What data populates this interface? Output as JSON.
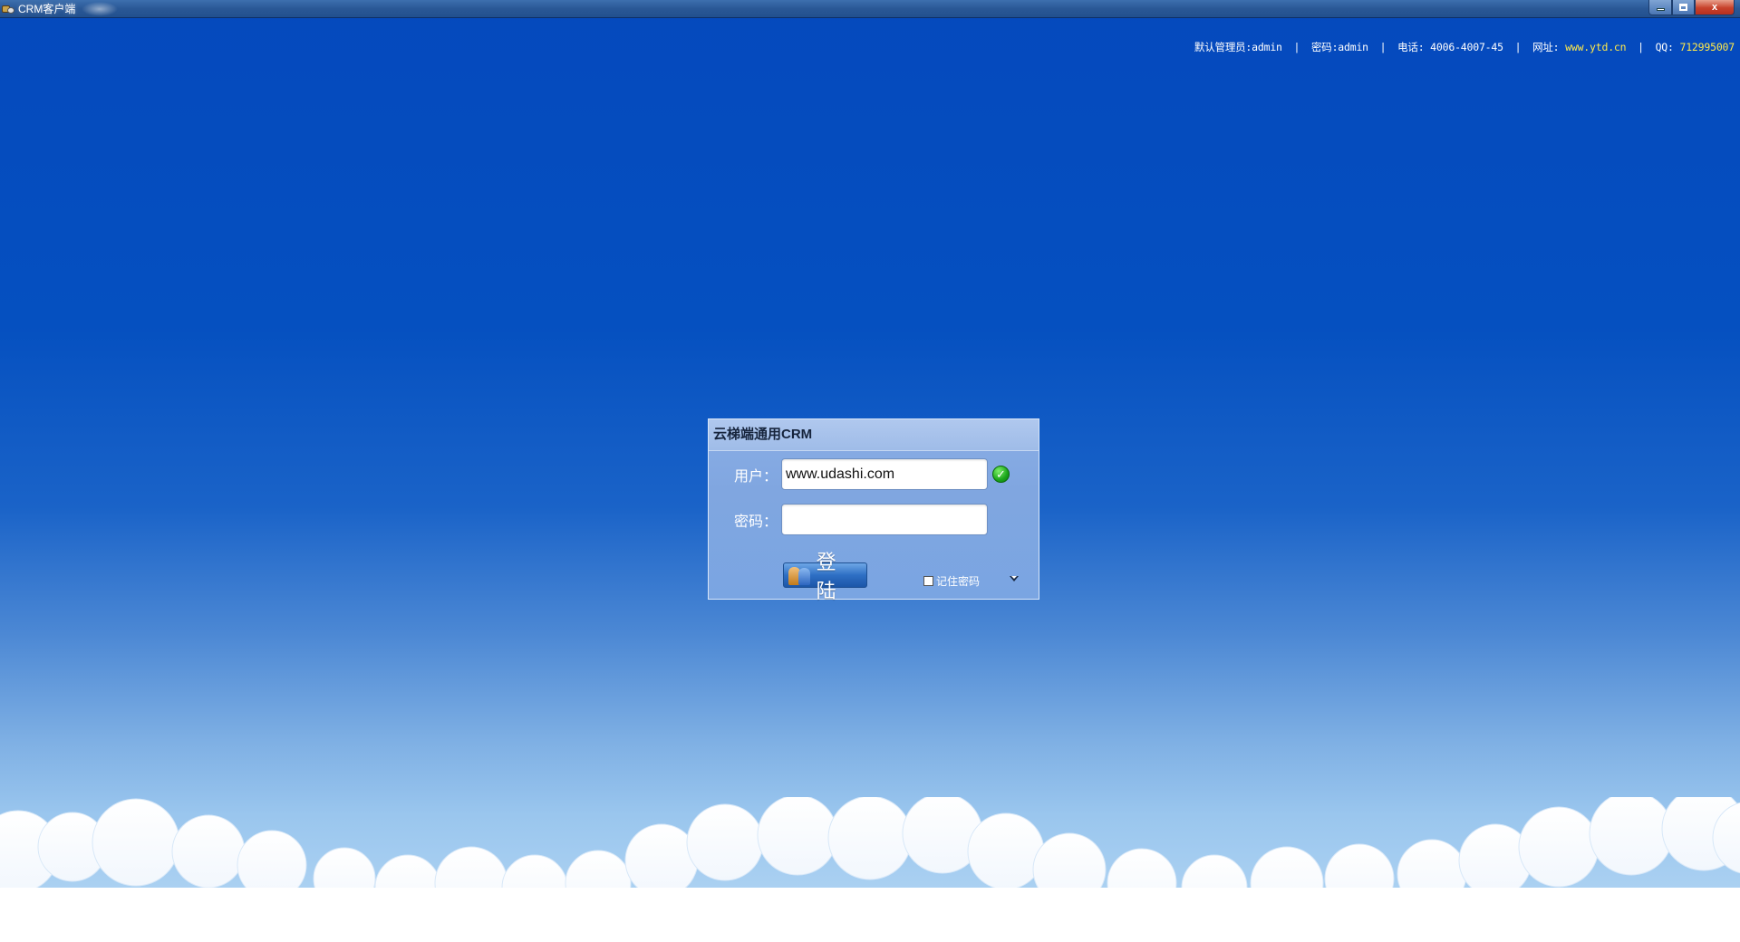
{
  "window": {
    "title": "CRM客户端",
    "controls": [
      "minimize",
      "maximize",
      "close"
    ],
    "close_symbol": "x"
  },
  "info": {
    "admin": "默认管理员:admin",
    "password": "密码:admin",
    "phone": "电话: 4006-4007-45",
    "website_label": "网址:",
    "website": "www.ytd.cn",
    "qq_label": "QQ:",
    "qq": "712995007",
    "separator": "|",
    "highlight_color": "#ffe94a"
  },
  "login": {
    "title": "云梯端通用CRM",
    "user_label": "用户：",
    "user_value": "www.udashi.com",
    "password_label": "密码：",
    "password_value": "",
    "login_button": "登陆",
    "remember_label": "记住密码",
    "remember_checked": false
  },
  "colors": {
    "sky_top": "#0549bd",
    "sky_bottom": "#b6d8f4"
  }
}
